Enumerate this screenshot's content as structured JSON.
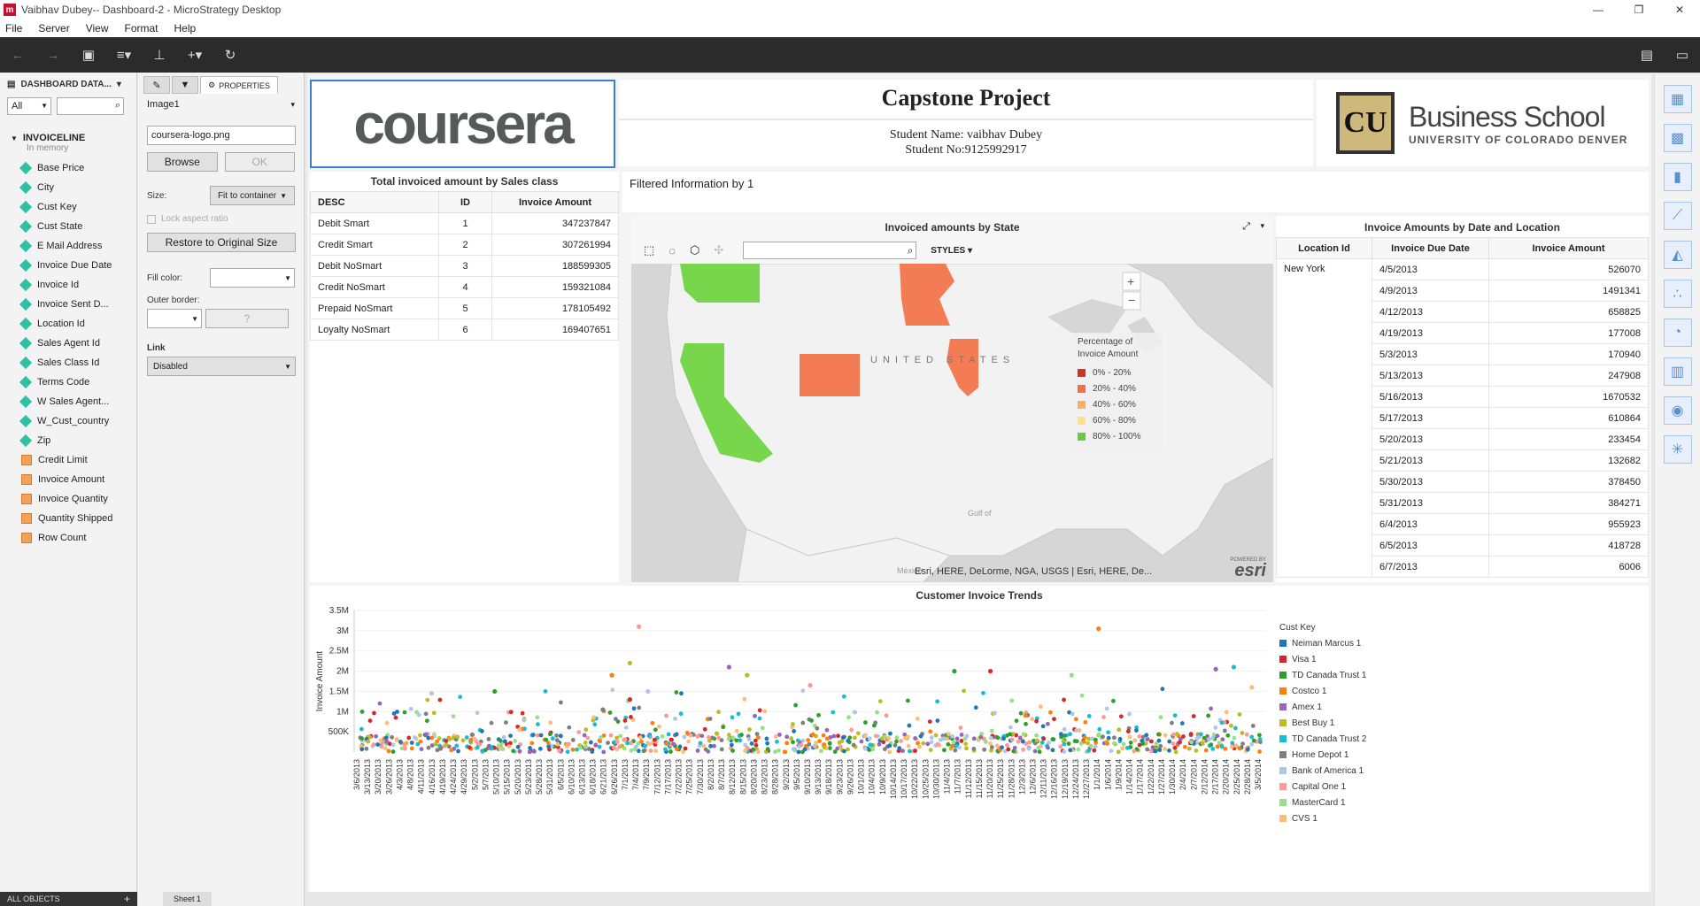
{
  "window": {
    "title": "Vaibhav Dubey-- Dashboard-2 - MicroStrategy Desktop",
    "app_icon": "m"
  },
  "menu": [
    "File",
    "Server",
    "View",
    "Format",
    "Help"
  ],
  "datapanel": {
    "header": "DASHBOARD DATA...",
    "filter_value": "All",
    "dataset": "INVOICELINE",
    "dataset_sub": "In memory",
    "attributes": [
      "Base Price",
      "City",
      "Cust Key",
      "Cust State",
      "E Mail Address",
      "Invoice Due Date",
      "Invoice Id",
      "Invoice Sent D...",
      "Location Id",
      "Sales Agent Id",
      "Sales Class Id",
      "Terms Code",
      "W Sales Agent...",
      "W_Cust_country",
      "Zip"
    ],
    "metrics": [
      "Credit Limit",
      "Invoice Amount",
      "Invoice Quantity",
      "Quantity Shipped",
      "Row Count"
    ],
    "footer": "ALL OBJECTS"
  },
  "props": {
    "tab_properties": "PROPERTIES",
    "object_name": "Image1",
    "file": "coursera-logo.png",
    "browse": "Browse",
    "ok": "OK",
    "size_label": "Size:",
    "size_value": "Fit to container",
    "lock_aspect": "Lock aspect ratio",
    "restore": "Restore to Original Size",
    "fill_label": "Fill color:",
    "border_label": "Outer border:",
    "border_q": "?",
    "link_label": "Link",
    "link_value": "Disabled",
    "sheet_tab": "Sheet 1"
  },
  "header": {
    "logo_text": "coursera",
    "title": "Capstone Project",
    "student_name": "Student Name: vaibhav Dubey",
    "student_no": "Student No:9125992917",
    "biz_mark": "CU",
    "biz_title": "Business School",
    "biz_sub": "UNIVERSITY OF COLORADO DENVER"
  },
  "sales_table": {
    "title": "Total invoiced amount by Sales class",
    "columns": [
      "DESC",
      "ID",
      "Invoice Amount"
    ],
    "rows": [
      [
        "Debit Smart",
        "1",
        "347237847"
      ],
      [
        "Credit Smart",
        "2",
        "307261994"
      ],
      [
        "Debit NoSmart",
        "3",
        "188599305"
      ],
      [
        "Credit NoSmart",
        "4",
        "159321084"
      ],
      [
        "Prepaid NoSmart",
        "5",
        "178105492"
      ],
      [
        "Loyalty NoSmart",
        "6",
        "169407651"
      ]
    ]
  },
  "filter_text": "Filtered Information by 1",
  "map": {
    "title": "Invoiced amounts by State",
    "styles_label": "STYLES",
    "country_label": "UNITED STATES",
    "legend_title": "Percentage of Invoice Amount",
    "legend": [
      {
        "label": "0% - 20%",
        "color": "#d73027"
      },
      {
        "label": "20% - 40%",
        "color": "#f46d43"
      },
      {
        "label": "40% - 60%",
        "color": "#fdae61"
      },
      {
        "label": "60% - 80%",
        "color": "#fee08b"
      },
      {
        "label": "80% - 100%",
        "color": "#66cc44"
      }
    ],
    "attribution": "Esri, HERE, DeLorme, NGA, USGS | Esri, HERE, De...",
    "esri_powered": "POWERED BY",
    "esri": "esri",
    "gulf_label": "Gulf of",
    "mexico_label": "México"
  },
  "date_table": {
    "title": "Invoice Amounts by Date and Location",
    "columns": [
      "Location Id",
      "Invoice Due Date",
      "Invoice Amount"
    ],
    "location": "New York",
    "rows": [
      [
        "4/5/2013",
        "526070"
      ],
      [
        "4/9/2013",
        "1491341"
      ],
      [
        "4/12/2013",
        "658825"
      ],
      [
        "4/19/2013",
        "177008"
      ],
      [
        "5/3/2013",
        "170940"
      ],
      [
        "5/13/2013",
        "247908"
      ],
      [
        "5/16/2013",
        "1670532"
      ],
      [
        "5/17/2013",
        "610864"
      ],
      [
        "5/20/2013",
        "233454"
      ],
      [
        "5/21/2013",
        "132682"
      ],
      [
        "5/30/2013",
        "378450"
      ],
      [
        "5/31/2013",
        "384271"
      ],
      [
        "6/4/2013",
        "955923"
      ],
      [
        "6/5/2013",
        "418728"
      ],
      [
        "6/7/2013",
        "6006"
      ]
    ]
  },
  "chart_data": {
    "type": "scatter",
    "title": "Customer Invoice Trends",
    "ylabel": "Invoice Amount",
    "ylim": [
      0,
      3500000
    ],
    "yticks": [
      "500K",
      "1M",
      "1.5M",
      "2M",
      "2.5M",
      "3M",
      "3.5M"
    ],
    "xticks": [
      "3/6/2013",
      "3/13/2013",
      "3/20/2013",
      "3/26/2013",
      "4/3/2013",
      "4/8/2013",
      "4/11/2013",
      "4/16/2013",
      "4/19/2013",
      "4/24/2013",
      "4/29/2013",
      "5/2/2013",
      "5/7/2013",
      "5/10/2013",
      "5/15/2013",
      "5/20/2013",
      "5/23/2013",
      "5/28/2013",
      "5/31/2013",
      "6/5/2013",
      "6/10/2013",
      "6/13/2013",
      "6/18/2013",
      "6/21/2013",
      "6/26/2013",
      "7/1/2013",
      "7/4/2013",
      "7/9/2013",
      "7/12/2013",
      "7/17/2013",
      "7/22/2013",
      "7/25/2013",
      "7/30/2013",
      "8/2/2013",
      "8/7/2013",
      "8/12/2013",
      "8/15/2013",
      "8/20/2013",
      "8/23/2013",
      "8/28/2013",
      "9/2/2013",
      "9/5/2013",
      "9/10/2013",
      "9/13/2013",
      "9/18/2013",
      "9/23/2013",
      "9/26/2013",
      "10/1/2013",
      "10/4/2013",
      "10/9/2013",
      "10/14/2013",
      "10/17/2013",
      "10/22/2013",
      "10/25/2013",
      "10/30/2013",
      "11/4/2013",
      "11/7/2013",
      "11/12/2013",
      "11/15/2013",
      "11/20/2013",
      "11/25/2013",
      "11/28/2013",
      "12/3/2013",
      "12/6/2013",
      "12/11/2013",
      "12/16/2013",
      "12/19/2013",
      "12/24/2013",
      "12/27/2013",
      "1/1/2014",
      "1/6/2014",
      "1/9/2014",
      "1/14/2014",
      "1/17/2014",
      "1/22/2014",
      "1/27/2014",
      "1/30/2014",
      "2/4/2014",
      "2/7/2014",
      "2/12/2014",
      "2/17/2014",
      "2/20/2014",
      "2/25/2014",
      "2/28/2014",
      "3/5/2014"
    ],
    "legend_title": "Cust Key",
    "series": [
      {
        "name": "Neiman Marcus 1",
        "color": "#1f77b4",
        "highlights": []
      },
      {
        "name": "Visa 1",
        "color": "#d62728",
        "highlights": [
          [
            0.7,
            2.0
          ],
          [
            0.3,
            1.3
          ]
        ]
      },
      {
        "name": "TD Canada Trust 1",
        "color": "#2ca02c",
        "highlights": [
          [
            0.15,
            1.5
          ],
          [
            0.66,
            2.0
          ]
        ]
      },
      {
        "name": "Costco 1",
        "color": "#ff7f0e",
        "highlights": [
          [
            0.82,
            3.05
          ],
          [
            0.28,
            1.9
          ]
        ]
      },
      {
        "name": "Amex 1",
        "color": "#9467bd",
        "highlights": [
          [
            0.41,
            2.1
          ],
          [
            0.95,
            2.05
          ]
        ]
      },
      {
        "name": "Best Buy 1",
        "color": "#bcbd22",
        "highlights": [
          [
            0.3,
            2.2
          ],
          [
            0.43,
            1.9
          ]
        ]
      },
      {
        "name": "TD Canada Trust 2",
        "color": "#17becf",
        "highlights": [
          [
            0.97,
            2.1
          ]
        ]
      },
      {
        "name": "Home Depot 1",
        "color": "#7f7f7f",
        "highlights": [
          [
            0.27,
            1.05
          ]
        ]
      },
      {
        "name": "Bank of America 1",
        "color": "#aec7e8",
        "highlights": [
          [
            0.32,
            1.5
          ],
          [
            0.08,
            1.45
          ]
        ]
      },
      {
        "name": "Capital One 1",
        "color": "#ff9896",
        "highlights": [
          [
            0.31,
            3.1
          ],
          [
            0.5,
            1.65
          ]
        ]
      },
      {
        "name": "MasterCard 1",
        "color": "#98df8a",
        "highlights": [
          [
            0.79,
            1.9
          ]
        ]
      },
      {
        "name": "CVS 1",
        "color": "#ffbb78",
        "highlights": [
          [
            0.99,
            1.6
          ]
        ]
      }
    ]
  }
}
